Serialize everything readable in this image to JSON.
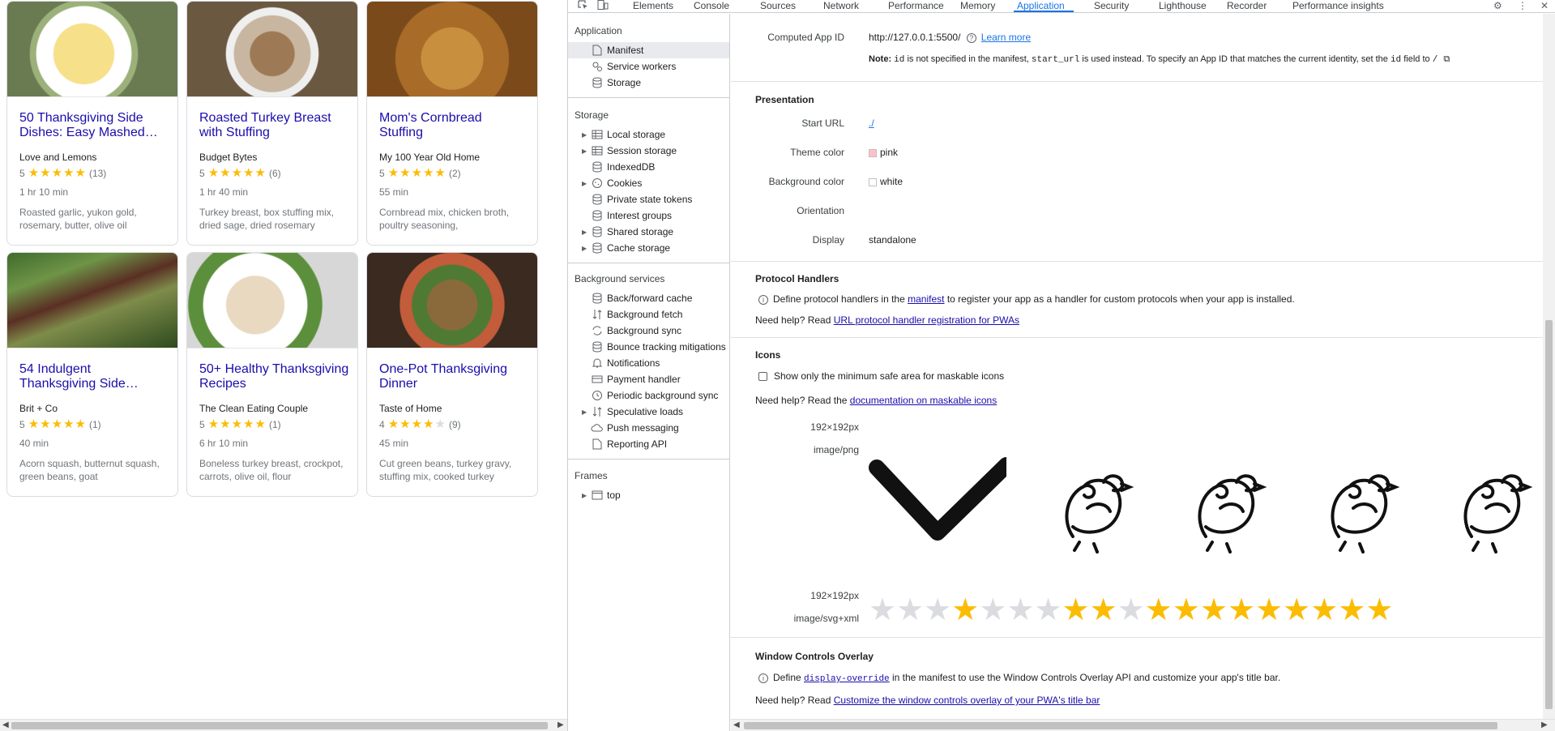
{
  "recipes": [
    {
      "title": "50 Thanksgiving Side Dishes: Easy Mashed…",
      "source": "Love and Lemons",
      "rating": "5",
      "stars": 5,
      "count": "(13)",
      "time": "1 hr 10 min",
      "ingredients": "Roasted garlic, yukon gold, rosemary, butter, olive oil",
      "image": "mashed-potatoes"
    },
    {
      "title": "Roasted Turkey Breast with Stuffing",
      "source": "Budget Bytes",
      "rating": "5",
      "stars": 5,
      "count": "(6)",
      "time": "1 hr 40 min",
      "ingredients": "Turkey breast, box stuffing mix, dried sage, dried rosemary",
      "image": "turkey-stuffing"
    },
    {
      "title": "Mom's Cornbread Stuffing",
      "source": "My 100 Year Old Home",
      "rating": "5",
      "stars": 5,
      "count": "(2)",
      "time": "55 min",
      "ingredients": "Cornbread mix, chicken broth, poultry seasoning,",
      "image": "cornbread-stuffing"
    },
    {
      "title": "54 Indulgent Thanksgiving Side…",
      "source": "Brit + Co",
      "rating": "5",
      "stars": 5,
      "count": "(1)",
      "time": "40 min",
      "ingredients": "Acorn squash, butternut squash, green beans, goat",
      "image": "green-beans"
    },
    {
      "title": "50+ Healthy Thanksgiving Recipes",
      "source": "The Clean Eating Couple",
      "rating": "5",
      "stars": 5,
      "count": "(1)",
      "time": "6 hr 10 min",
      "ingredients": "Boneless turkey breast, crockpot, carrots, olive oil, flour",
      "image": "turkey-plate"
    },
    {
      "title": "One-Pot Thanksgiving Dinner",
      "source": "Taste of Home",
      "rating": "4",
      "stars": 4,
      "count": "(9)",
      "time": "45 min",
      "ingredients": "Cut green beans, turkey gravy, stuffing mix, cooked turkey",
      "image": "one-pot-dinner"
    }
  ],
  "devtools": {
    "tabs": [
      "Elements",
      "Console",
      "Sources",
      "Network",
      "Performance",
      "Memory",
      "Application",
      "Security",
      "Lighthouse",
      "Recorder",
      "Performance insights"
    ],
    "active_tab": "Application",
    "sidebar": {
      "application_header": "Application",
      "application_items": [
        {
          "label": "Manifest",
          "icon": "file-icon"
        },
        {
          "label": "Service workers",
          "icon": "gears-icon"
        },
        {
          "label": "Storage",
          "icon": "database-icon"
        }
      ],
      "storage_header": "Storage",
      "storage_items": [
        {
          "label": "Local storage",
          "icon": "table-icon",
          "expandable": true
        },
        {
          "label": "Session storage",
          "icon": "table-icon",
          "expandable": true
        },
        {
          "label": "IndexedDB",
          "icon": "database-icon",
          "expandable": false
        },
        {
          "label": "Cookies",
          "icon": "cookie-icon",
          "expandable": true
        },
        {
          "label": "Private state tokens",
          "icon": "database-icon",
          "expandable": false
        },
        {
          "label": "Interest groups",
          "icon": "database-icon",
          "expandable": false
        },
        {
          "label": "Shared storage",
          "icon": "database-icon",
          "expandable": true
        },
        {
          "label": "Cache storage",
          "icon": "database-icon",
          "expandable": true
        }
      ],
      "background_header": "Background services",
      "background_items": [
        {
          "label": "Back/forward cache",
          "icon": "database-icon",
          "expandable": false
        },
        {
          "label": "Background fetch",
          "icon": "arrows-icon",
          "expandable": false
        },
        {
          "label": "Background sync",
          "icon": "sync-icon",
          "expandable": false
        },
        {
          "label": "Bounce tracking mitigations",
          "icon": "database-icon",
          "expandable": false
        },
        {
          "label": "Notifications",
          "icon": "bell-icon",
          "expandable": false
        },
        {
          "label": "Payment handler",
          "icon": "card-icon",
          "expandable": false
        },
        {
          "label": "Periodic background sync",
          "icon": "clock-icon",
          "expandable": false
        },
        {
          "label": "Speculative loads",
          "icon": "arrows-icon",
          "expandable": true
        },
        {
          "label": "Push messaging",
          "icon": "cloud-icon",
          "expandable": false
        },
        {
          "label": "Reporting API",
          "icon": "file-icon",
          "expandable": false
        }
      ],
      "frames_header": "Frames",
      "frames_items": [
        {
          "label": "top",
          "icon": "frame-icon",
          "expandable": true
        }
      ]
    },
    "manifest": {
      "computed_app_id_label": "Computed App ID",
      "computed_app_id": "http://127.0.0.1:5500/",
      "learn_more": "Learn more",
      "note_label": "Note:",
      "note_id": "id",
      "note_text_1": "is not specified in the manifest,",
      "note_start_url": "start_url",
      "note_text_2": "is used instead. To specify an App ID that matches the current identity, set the",
      "note_id2": "id",
      "note_text_3": "field to",
      "note_slash": "/",
      "presentation_title": "Presentation",
      "start_url_label": "Start URL",
      "start_url": "./",
      "theme_color_label": "Theme color",
      "theme_color": "pink",
      "theme_color_hex": "#ffc0cb",
      "background_color_label": "Background color",
      "background_color": "white",
      "background_color_hex": "#ffffff",
      "orientation_label": "Orientation",
      "orientation": "",
      "display_label": "Display",
      "display": "standalone",
      "protocol_title": "Protocol Handlers",
      "protocol_text_1": "Define protocol handlers in the",
      "protocol_link": "manifest",
      "protocol_text_2": "to register your app as a handler for custom protocols when your app is installed.",
      "protocol_help": "Need help? Read",
      "protocol_help_link": "URL protocol handler registration for PWAs",
      "icons_title": "Icons",
      "icons_checkbox": "Show only the minimum safe area for maskable icons",
      "icons_help": "Need help? Read the",
      "icons_help_link": "documentation on maskable icons",
      "icon1_size": "192×192px",
      "icon1_type": "image/png",
      "icon2_size": "192×192px",
      "icon2_type": "image/svg+xml",
      "wco_title": "Window Controls Overlay",
      "wco_text_1": "Define",
      "wco_code": "display-override",
      "wco_text_2": "in the manifest to use the Window Controls Overlay API and customize your app's title bar.",
      "wco_help": "Need help? Read",
      "wco_help_link": "Customize the window controls overlay of your PWA's title bar"
    }
  },
  "colors": {
    "link": "#1a0dab",
    "devtools_link": "#1a73e8",
    "star_gold": "#fbbc04",
    "star_gray": "#dadce0"
  }
}
